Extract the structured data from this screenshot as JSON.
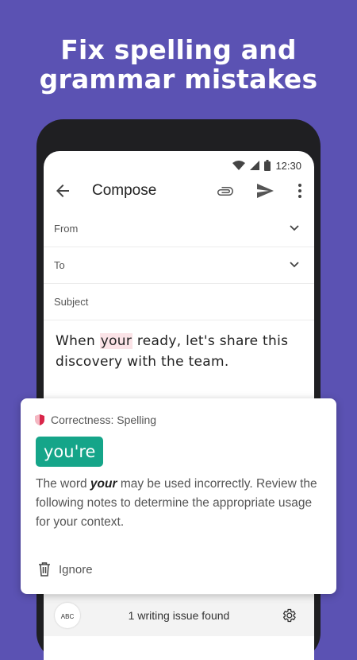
{
  "headline": {
    "line1": "Fix spelling and",
    "line2": "grammar mistakes"
  },
  "status": {
    "time": "12:30"
  },
  "appbar": {
    "title": "Compose",
    "icons": [
      "back-arrow-icon",
      "paperclip-icon",
      "send-icon",
      "more-vert-icon"
    ]
  },
  "fields": {
    "from": "From",
    "to": "To",
    "subject": "Subject"
  },
  "email_body": {
    "before": "When ",
    "flagged": "your",
    "after": " ready, let's share this discovery with the team."
  },
  "suggestion_card": {
    "category": "Correctness: Spelling",
    "suggestion": "you're",
    "desc_pre": "The word ",
    "desc_word": "your",
    "desc_post": " may be used incorrectly. Review the following notes to determine the appropriate usage for your context.",
    "ignore_label": "Ignore",
    "colors": {
      "suggestion_bg": "#15a589",
      "shield": "#d9264a"
    }
  },
  "bottom_bar": {
    "badge": "ABC",
    "issues_text": "1 writing issue found"
  },
  "colors": {
    "background": "#5b52b3",
    "highlight": "#fbe3e7"
  }
}
